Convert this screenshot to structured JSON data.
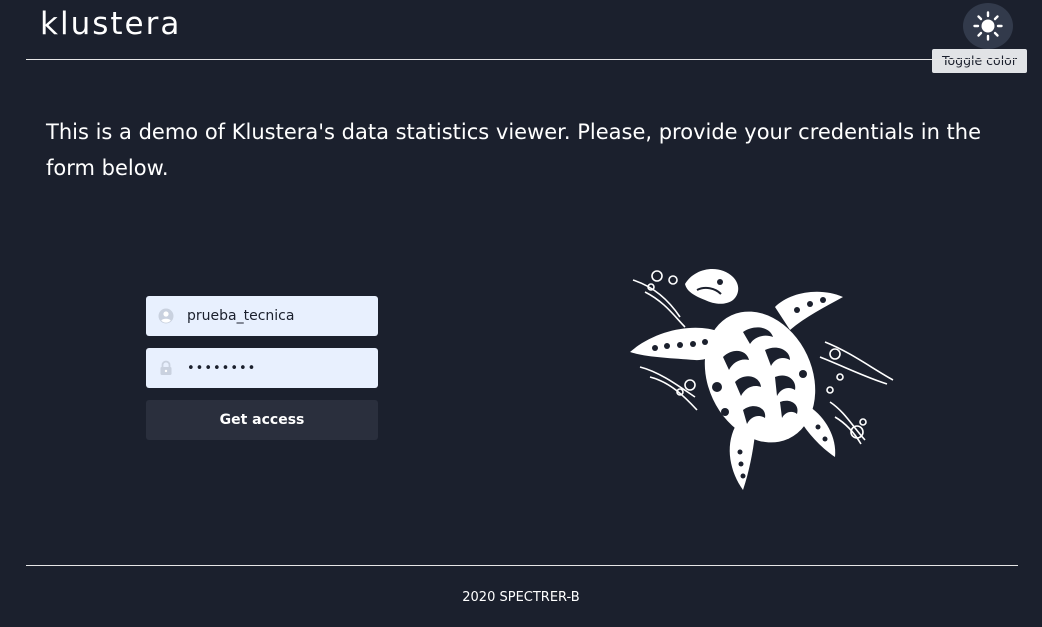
{
  "header": {
    "logo_text": "klustera",
    "toggle_tooltip": "Toggle color",
    "toggle_icon": "sun-icon"
  },
  "main": {
    "intro_text": "This is a demo of Klustera's data statistics viewer. Please, provide your credentials in the form below.",
    "form": {
      "username_value": "prueba_tecnica",
      "username_icon": "user-icon",
      "password_value": "••••••••",
      "password_icon": "lock-icon",
      "submit_label": "Get access"
    },
    "illustration": "sea-turtle"
  },
  "footer": {
    "text": "2020 SPECTRER-B"
  },
  "colors": {
    "background": "#1b202d",
    "input_background": "#e8f0fe",
    "button_background": "#2a2f3d",
    "toggle_background": "#323a4b",
    "tooltip_background": "#e1e3e6"
  }
}
